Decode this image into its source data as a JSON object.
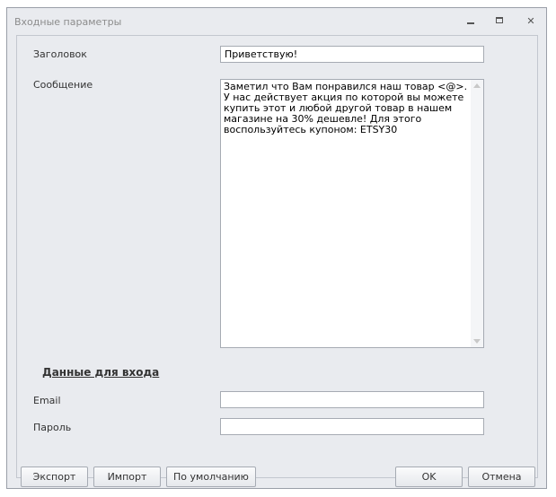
{
  "window": {
    "title": "Входные параметры",
    "controls": {
      "minimize": "",
      "maximize": "",
      "close": "✕"
    }
  },
  "form": {
    "subject_label": "Заголовок",
    "subject_value": "Приветствую!",
    "message_label": "Сообщение",
    "message_value": "Заметил что Вам понравился наш товар <@>.\nУ нас действует акция по которой вы можете купить этот и любой другой товар в нашем магазине на 30% дешевле! Для этого воспользуйтесь купоном: ETSY30"
  },
  "login": {
    "section_title": "Данные для входа",
    "email_label": "Email",
    "email_value": "",
    "password_label": "Пароль",
    "password_value": ""
  },
  "buttons": {
    "export": "Экспорт",
    "import": "Импорт",
    "defaults": "По умолчанию",
    "ok": "OK",
    "cancel": "Отмена"
  }
}
